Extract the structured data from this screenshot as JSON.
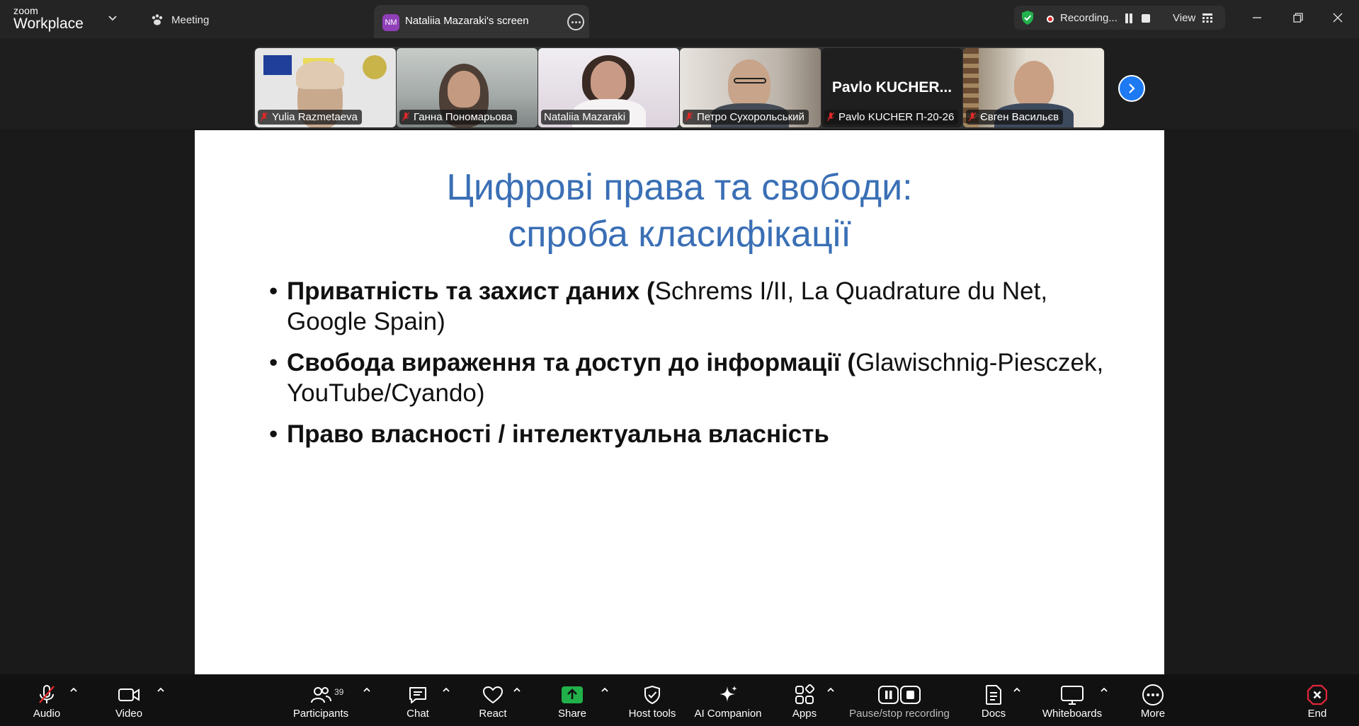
{
  "app": {
    "brand_small": "zoom",
    "brand_large": "Workplace"
  },
  "tabs": {
    "meeting_label": "Meeting",
    "screen_initials": "NM",
    "screen_label": "Nataliia Mazaraki's screen"
  },
  "recording": {
    "status": "Recording...",
    "view_label": "View"
  },
  "participants_strip": [
    {
      "name": "Yulia Razmetaeva",
      "muted": true
    },
    {
      "name": "Ганна Пономарьова",
      "muted": true
    },
    {
      "name": "Nataliia Mazaraki",
      "muted": false,
      "active": true
    },
    {
      "name": "Петро Сухорольський",
      "muted": true
    },
    {
      "name": "Pavlo KUCHER П-20-26",
      "display": "Pavlo  KUCHER...",
      "muted": true
    },
    {
      "name": "Євген Васильєв",
      "muted": true
    }
  ],
  "slide": {
    "title_line1": "Цифрові права та свободи:",
    "title_line2": "спроба класифікації",
    "bullets": [
      {
        "bold": "Приватність та захист даних (",
        "normal": "Schrems I/II, La Quadrature du Net, Google Spain)"
      },
      {
        "bold": "Свобода вираження та доступ до інформації (",
        "normal": "Glawischnig-Piesczek, YouTube/Cyando)"
      },
      {
        "bold": "Право власності / інтелектуальна власність",
        "normal": ""
      }
    ]
  },
  "toolbar": {
    "audio": "Audio",
    "video": "Video",
    "participants": "Participants",
    "participants_count": "39",
    "chat": "Chat",
    "react": "React",
    "share": "Share",
    "host_tools": "Host tools",
    "ai_companion": "AI Companion",
    "apps": "Apps",
    "pause_stop": "Pause/stop recording",
    "docs": "Docs",
    "whiteboards": "Whiteboards",
    "more": "More",
    "end": "End"
  },
  "colors": {
    "accent_green": "#2ed3a4",
    "share_green": "#21b14a",
    "title_blue": "#3a6fb5",
    "end_red": "#e0263a"
  }
}
